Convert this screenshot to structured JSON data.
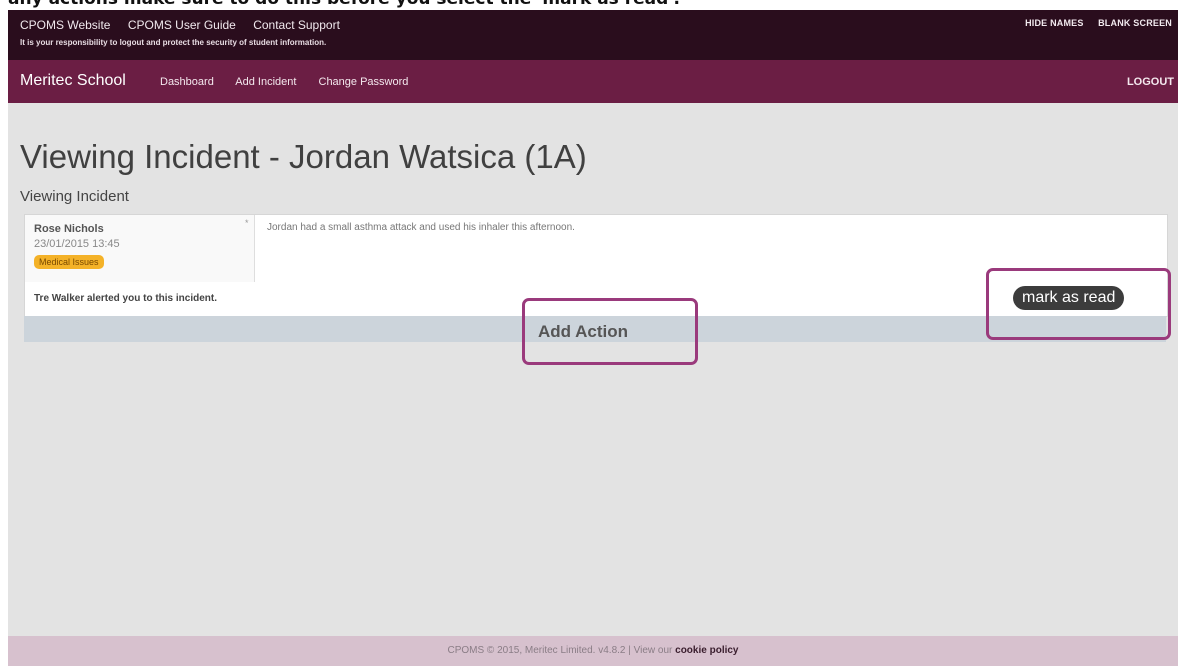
{
  "caption": "any actions make sure to do this before you select the 'mark as read'.",
  "topbar": {
    "links": [
      "CPOMS Website",
      "CPOMS User Guide",
      "Contact Support"
    ],
    "notice": "It is your responsibility to logout and protect the security of student information.",
    "hide_names": "HIDE NAMES",
    "blank_screen": "BLANK SCREEN"
  },
  "navbar": {
    "brand": "Meritec School",
    "links": [
      "Dashboard",
      "Add Incident",
      "Change Password"
    ],
    "logout": "LOGOUT"
  },
  "page": {
    "title": "Viewing Incident - Jordan Watsica (1A)",
    "section": "Viewing Incident"
  },
  "incident": {
    "author": "Rose Nichols",
    "date": "23/01/2015 13:45",
    "tag": "Medical Issues",
    "star": "*",
    "text": "Jordan had a small asthma attack and used his inhaler this afternoon."
  },
  "alert": {
    "text": "Tre Walker alerted you to this incident.",
    "mark_label": "mark as read"
  },
  "action": {
    "add_label": "Add Action"
  },
  "footer": {
    "text": "CPOMS © 2015, Meritec Limited. v4.8.2 | View our ",
    "cookie": "cookie policy"
  },
  "colors": {
    "topbar": "#2a0d1d",
    "navbar": "#6b1e44",
    "highlight": "#9a3a7c",
    "tag": "#f4b228"
  }
}
